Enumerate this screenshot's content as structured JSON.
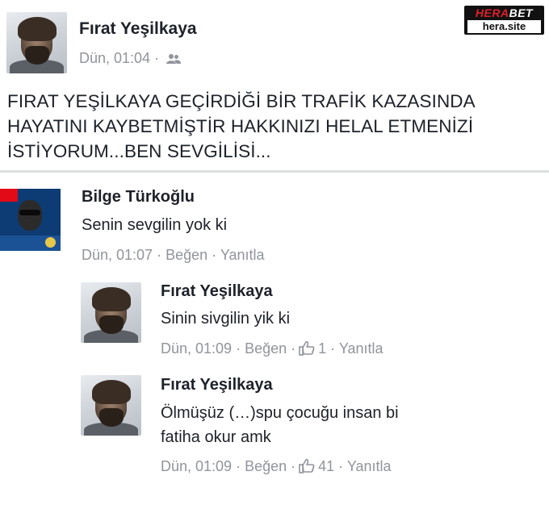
{
  "watermark": {
    "brand_part1": "HERA",
    "brand_part2": "BET",
    "site": "hera.site"
  },
  "post": {
    "author": "Fırat Yeşilkaya",
    "timestamp": "Dün, 01:04",
    "separator": "·",
    "audience_icon": "friends-icon",
    "text_lines": [
      "FIRAT YEŞİLKAYA GEÇİRDİĞİ BİR TRAFİK KAZASINDA",
      "HAYATINI KAYBETMİŞTİR HAKKINIZI HELAL ETMENİZİ",
      "İSTİYORUM...BEN SEVGİLİSİ..."
    ]
  },
  "comments": [
    {
      "author": "Bilge Türkoğlu",
      "text": "Senin sevgilin yok ki",
      "timestamp": "Dün, 01:07",
      "like_label": "Beğen",
      "reply_label": "Yanıtla",
      "avatar_icon": "turkish-flag-profile-avatar"
    },
    {
      "author": "Fırat Yeşilkaya",
      "text": "Sinin sivgilin yik ki",
      "timestamp": "Dün, 01:09",
      "like_label": "Beğen",
      "like_count": "1",
      "reply_label": "Yanıtla",
      "like_icon": "thumbs-up-icon"
    },
    {
      "author": "Fırat Yeşilkaya",
      "text_lines": [
        "Ölmüşüz (…)spu çocuğu insan bi",
        "fatiha okur amk"
      ],
      "timestamp": "Dün, 01:09",
      "like_label": "Beğen",
      "like_count": "41",
      "reply_label": "Yanıtla",
      "like_icon": "thumbs-up-icon"
    }
  ],
  "colors": {
    "text": "#1d2129",
    "meta": "#90949c",
    "divider": "#dddfe2",
    "watermark_red": "#e0202a"
  }
}
